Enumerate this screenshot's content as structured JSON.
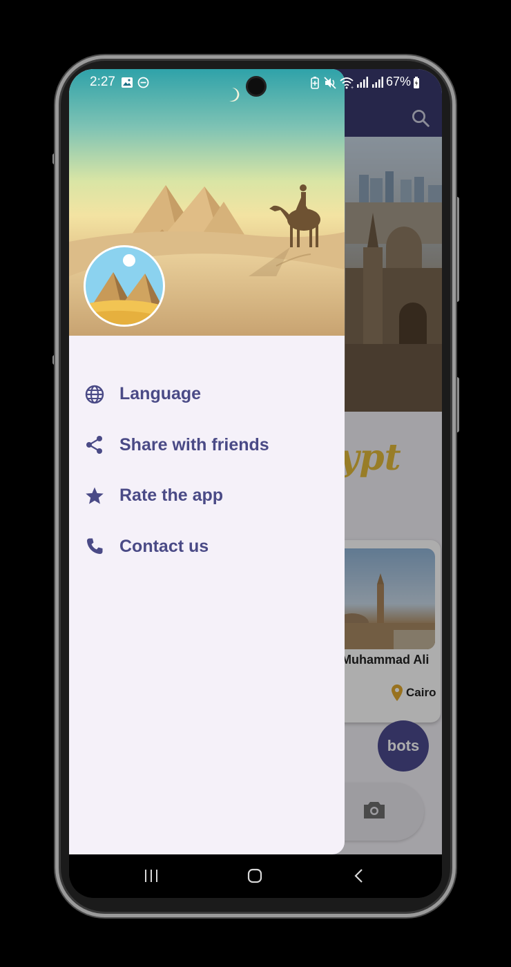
{
  "status_bar": {
    "time": "2:27",
    "battery": "67%",
    "icons": [
      "image-icon",
      "dnd-icon",
      "battery-saver-icon",
      "mute-icon",
      "wifi-icon",
      "signal-icon",
      "signal-icon",
      "battery-icon"
    ]
  },
  "drawer": {
    "menu": [
      {
        "label": "Language",
        "icon": "globe-icon"
      },
      {
        "label": "Share with friends",
        "icon": "share-icon"
      },
      {
        "label": "Rate the app",
        "icon": "star-icon"
      },
      {
        "label": "Contact us",
        "icon": "phone-icon"
      }
    ]
  },
  "background_app": {
    "script_text": "ypt",
    "card": {
      "title": "Muhammad Ali",
      "location": "Cairo"
    },
    "fab_label": "bots"
  },
  "colors": {
    "accent": "#4a4a86",
    "drawer_bg": "#f5f1f9",
    "topbar": "#38396e",
    "pin": "#e0a82e"
  },
  "nav": {
    "buttons": [
      "recents-icon",
      "home-icon",
      "back-icon"
    ]
  }
}
